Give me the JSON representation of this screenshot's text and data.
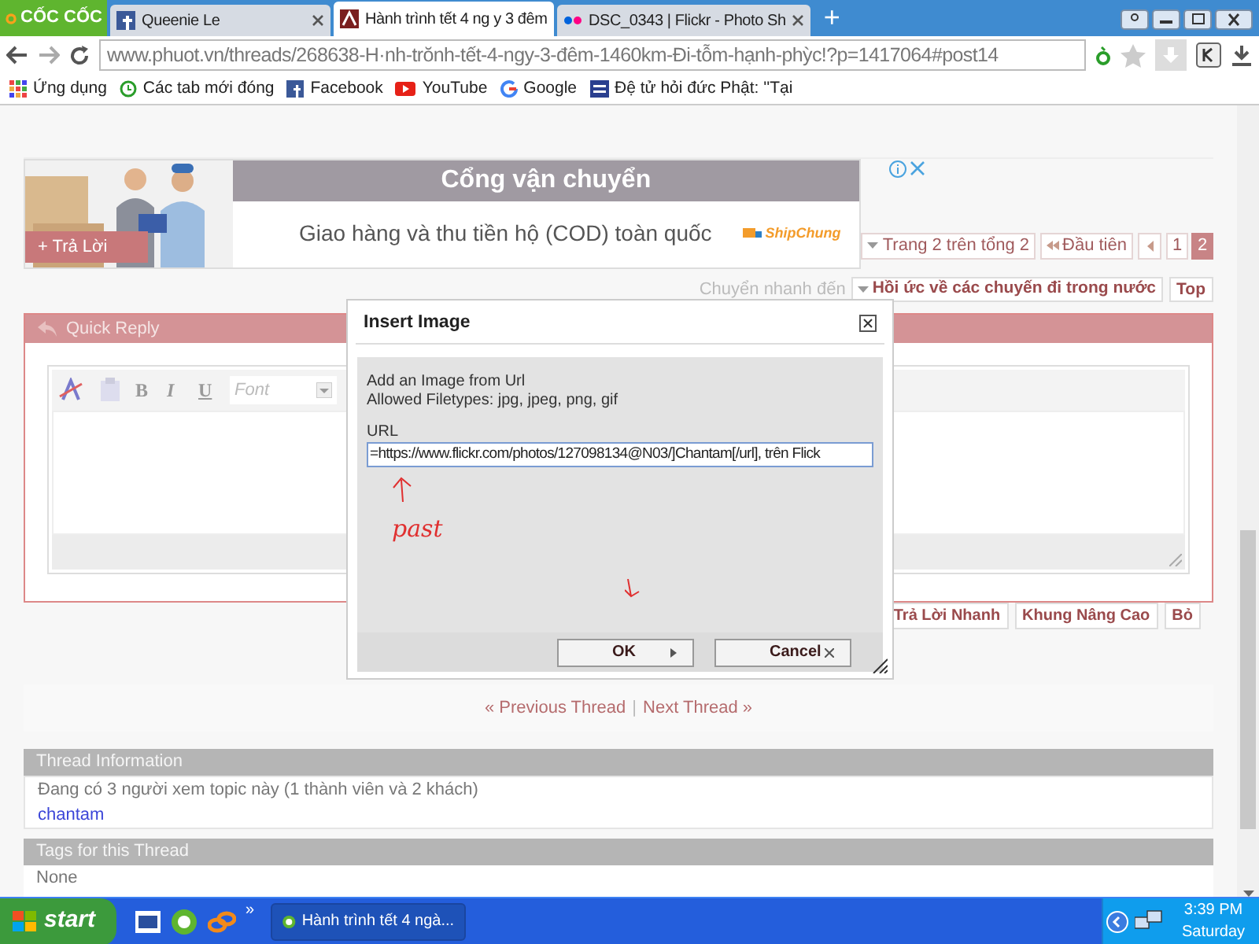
{
  "browser": {
    "logo": "CỐC CỐC",
    "tabs": [
      {
        "title": "Queenie Le",
        "selected": false
      },
      {
        "title": "Hành trình tết 4 ng y 3 đêm",
        "selected": true
      },
      {
        "title": "DSC_0343 | Flickr - Photo Sh",
        "selected": false
      }
    ],
    "new_tab": "+",
    "address": "www.phuot.vn/threads/268638-H·nh-trŏnh-tết-4-ngy-3-đêm-1460km-Đi-tỗm-hạnh-phỳc!?p=1417064#post14",
    "bookmarks": [
      "Ứng dụng",
      "Các tab mới đóng",
      "Facebook",
      "YouTube",
      "Google",
      "Đệ tử hỏi đức Phật: ''Tại"
    ]
  },
  "ad": {
    "title": "Cổng vận chuyển",
    "text": "Giao hàng và thu tiền hộ (COD) toàn quốc",
    "brand": "ShipChung"
  },
  "reply_button": "+ Trả Lời",
  "pagination": {
    "label": "Trang 2 trên tổng 2",
    "first": "Đầu tiên",
    "pages": [
      {
        "label": "1",
        "selected": false
      },
      {
        "label": "2",
        "selected": true
      }
    ]
  },
  "jump": {
    "label": "Chuyển nhanh đến",
    "forum": "Hồi ức về các chuyến đi trong nước",
    "top": "Top"
  },
  "quick_reply": {
    "title": "Quick Reply",
    "format_buttons": [
      "B",
      "I",
      "U"
    ],
    "font": "Font",
    "buttons": [
      "Trả Lời Nhanh",
      "Khung Nâng Cao",
      "Bỏ"
    ]
  },
  "dialog": {
    "title": "Insert Image",
    "intro": "Add an Image from Url",
    "filetypes": "Allowed Filetypes: jpg, jpeg, png, gif",
    "url_label": "URL",
    "url_value": "=https://www.flickr.com/photos/127098134@N03/]Chantam[/url], trên Flick",
    "annotation": "past",
    "buttons": [
      "OK",
      "Cancel"
    ]
  },
  "nav": {
    "previous": "« Previous Thread",
    "separator": "|",
    "next": "Next Thread »"
  },
  "thread_info": {
    "title": "Thread Information",
    "viewers": "Đang có 3 người xem topic này (1 thành viên và 2 khách)",
    "members": [
      "chantam"
    ]
  },
  "tags": {
    "title": "Tags for this Thread",
    "body": "None"
  },
  "taskbar": {
    "start": "start",
    "more": "»",
    "task": "Hành trình tết 4 ngà...",
    "time": "3:39 PM",
    "day": "Saturday"
  }
}
